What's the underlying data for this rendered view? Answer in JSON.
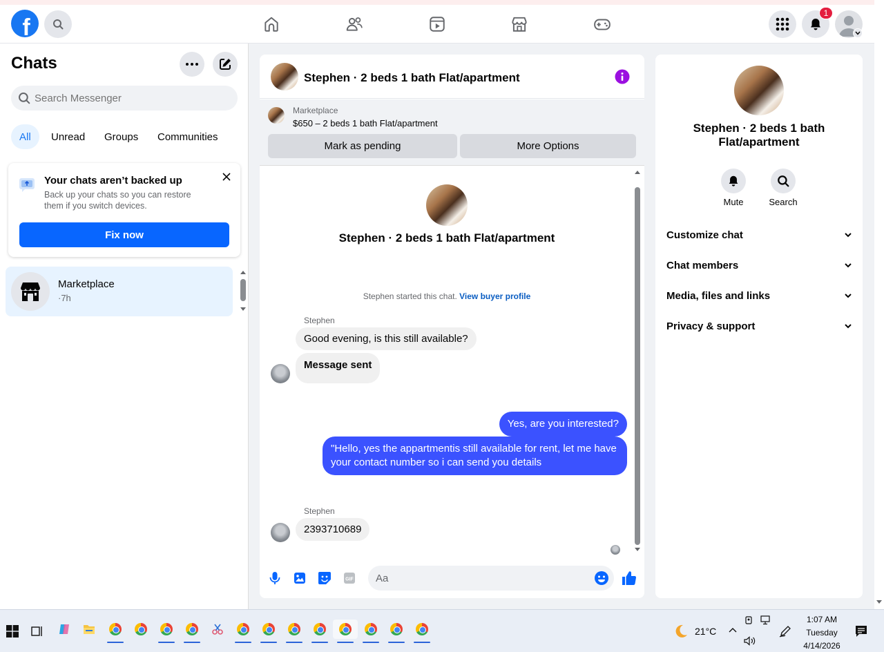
{
  "topnav": {
    "logo": "f",
    "notification_count": "1",
    "icons": [
      "home-icon",
      "friends-icon",
      "video-icon",
      "marketplace-icon",
      "gaming-icon"
    ]
  },
  "sidebar": {
    "title": "Chats",
    "search_placeholder": "Search Messenger",
    "filters": [
      {
        "label": "All",
        "active": true
      },
      {
        "label": "Unread",
        "active": false
      },
      {
        "label": "Groups",
        "active": false
      },
      {
        "label": "Communities",
        "active": false
      }
    ],
    "backup": {
      "title": "Your chats aren’t backed up",
      "body": "Back up your chats so you can restore them if you switch devices.",
      "button": "Fix now"
    },
    "chats": [
      {
        "name": "Marketplace",
        "time": "·7h"
      }
    ]
  },
  "conversation": {
    "title": "Stephen · 2 beds 1 bath Flat/apartment",
    "marketplace": {
      "label": "Marketplace",
      "listing": "$650 – 2 beds 1 bath Flat/apartment",
      "btn_pending": "Mark as pending",
      "btn_more": "More Options"
    },
    "intro_title": "Stephen · 2 beds 1 bath Flat/apartment",
    "started_text": "Stephen started this chat.",
    "buyer_link": "View buyer profile",
    "messages": [
      {
        "sender": "Stephen",
        "text": "Good evening, is this still available?"
      },
      {
        "sender": "",
        "text": "Message sent"
      },
      {
        "sender": "me",
        "text": "Yes, are you interested?"
      },
      {
        "sender": "me",
        "text": "\"Hello, yes the appartmentis still available for rent, let me have your contact number so i can send you details"
      },
      {
        "sender": "Stephen",
        "text": "2393710689"
      }
    ],
    "composer_placeholder": "Aa"
  },
  "info_panel": {
    "title": "Stephen · 2 beds 1 bath Flat/apartment",
    "actions": [
      {
        "label": "Mute"
      },
      {
        "label": "Search"
      }
    ],
    "sections": [
      "Customize chat",
      "Chat members",
      "Media, files and links",
      "Privacy & support"
    ]
  },
  "taskbar": {
    "weather": "21°C",
    "time": "1:07 AM",
    "day": "Tuesday",
    "date": "4/14/2026"
  }
}
